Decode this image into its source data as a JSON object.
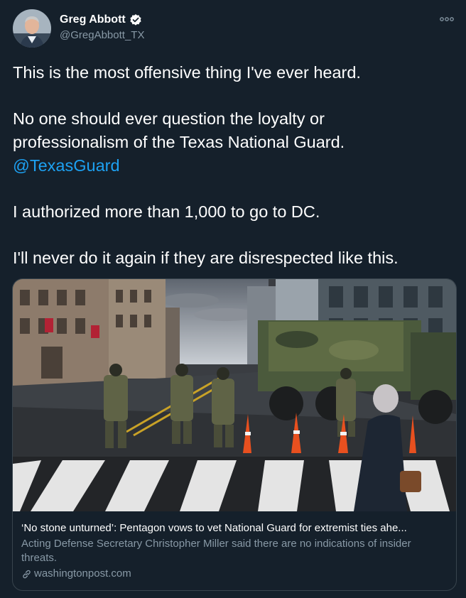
{
  "author": {
    "name": "Greg Abbott",
    "handle": "@GregAbbott_TX",
    "verified": true
  },
  "tweet": {
    "line1": "This is the most offensive thing I've ever heard.",
    "line2": "No one should ever question the loyalty or",
    "line3": "professionalism of the Texas National Guard.",
    "mention": "@TexasGuard",
    "line4": "I authorized more than 1,000 to go to DC.",
    "line5": "I'll never do it again if they are disrespected like this."
  },
  "card": {
    "title": "‘No stone unturned’: Pentagon vows to vet National Guard for extremist ties ahe...",
    "description": "Acting Defense Secretary Christopher Miller said there are no indications of insider threats.",
    "domain": "washingtonpost.com"
  },
  "icons": {
    "verified": "verified-badge-icon",
    "more": "more-options-icon",
    "link": "link-icon"
  },
  "colors": {
    "background": "#15202b",
    "accent": "#1da1f2",
    "muted": "#8899a6",
    "border": "#38444d"
  }
}
